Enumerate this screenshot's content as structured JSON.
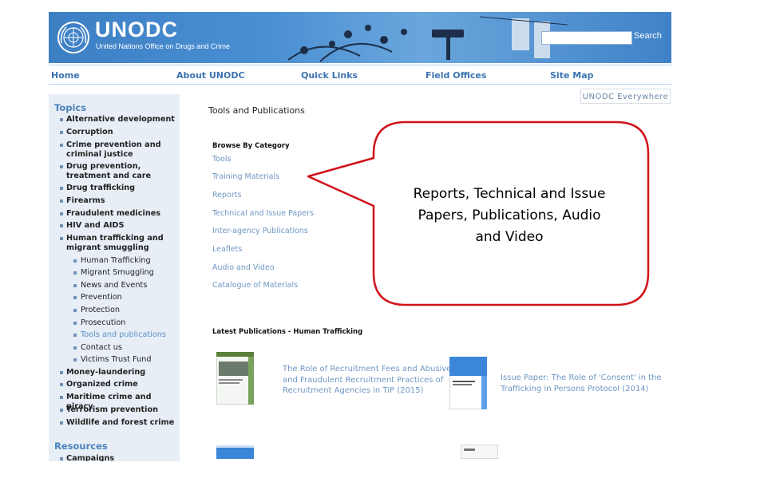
{
  "header": {
    "brand_name": "UNODC",
    "brand_sub": "United Nations Office on Drugs and Crime",
    "search": {
      "value": "",
      "placeholder": ""
    },
    "search_button": "Search",
    "accent_color": "#4a8fd3"
  },
  "nav": {
    "items": [
      {
        "label": "Home"
      },
      {
        "label": "About UNODC"
      },
      {
        "label": "Quick Links"
      },
      {
        "label": "Field Offices"
      },
      {
        "label": "Site Map"
      }
    ]
  },
  "everywhere_label": "UNODC Everywhere",
  "sidebar": {
    "topics_heading": "Topics",
    "topics": [
      {
        "label": "Alternative development"
      },
      {
        "label": "Corruption"
      },
      {
        "label": "Crime prevention and criminal justice"
      },
      {
        "label": "Drug prevention, treatment and care"
      },
      {
        "label": "Drug trafficking"
      },
      {
        "label": "Firearms"
      },
      {
        "label": "Fraudulent medicines"
      },
      {
        "label": "HIV and AIDS"
      },
      {
        "label": "Human trafficking and migrant smuggling"
      },
      {
        "label": "Money-laundering"
      },
      {
        "label": "Organized crime"
      },
      {
        "label": "Maritime crime and piracy"
      },
      {
        "label": "Terrorism prevention"
      },
      {
        "label": "Wildlife and forest crime"
      }
    ],
    "subtopics": [
      {
        "label": "Human Trafficking"
      },
      {
        "label": "Migrant Smuggling"
      },
      {
        "label": "News and Events"
      },
      {
        "label": "Prevention"
      },
      {
        "label": "Protection"
      },
      {
        "label": "Prosecution"
      },
      {
        "label": "Tools and publications",
        "active": true
      },
      {
        "label": "Contact us"
      },
      {
        "label": "Victims Trust Fund"
      }
    ],
    "resources_heading": "Resources",
    "resources_first": "Campaigns"
  },
  "main": {
    "page_title": "Tools and Publications",
    "browse_heading": "Browse By Category",
    "categories": [
      {
        "label": "Tools"
      },
      {
        "label": "Training Materials"
      },
      {
        "label": "Reports"
      },
      {
        "label": "Technical and Issue Papers"
      },
      {
        "label": "Inter-agency Publications"
      },
      {
        "label": "Leaflets"
      },
      {
        "label": "Audio and Video"
      },
      {
        "label": "Catalogue of Materials"
      }
    ],
    "latest_heading": "Latest Publications - Human Trafficking",
    "publications": [
      {
        "title_lines": [
          "The Role of Recruitment Fees and Abusive",
          "and Fraudulent Recruitment Practices of",
          "Recruitment Agencies in TiP (2015)"
        ]
      },
      {
        "title_lines": [
          "Issue Paper: The Role of 'Consent' in the",
          "Trafficking in Persons Protocol (2014)"
        ]
      }
    ]
  },
  "callout": {
    "lines": [
      "Reports, Technical and Issue",
      "Papers, Publications, Audio",
      "and Video"
    ],
    "border_color": "#d0131a"
  }
}
